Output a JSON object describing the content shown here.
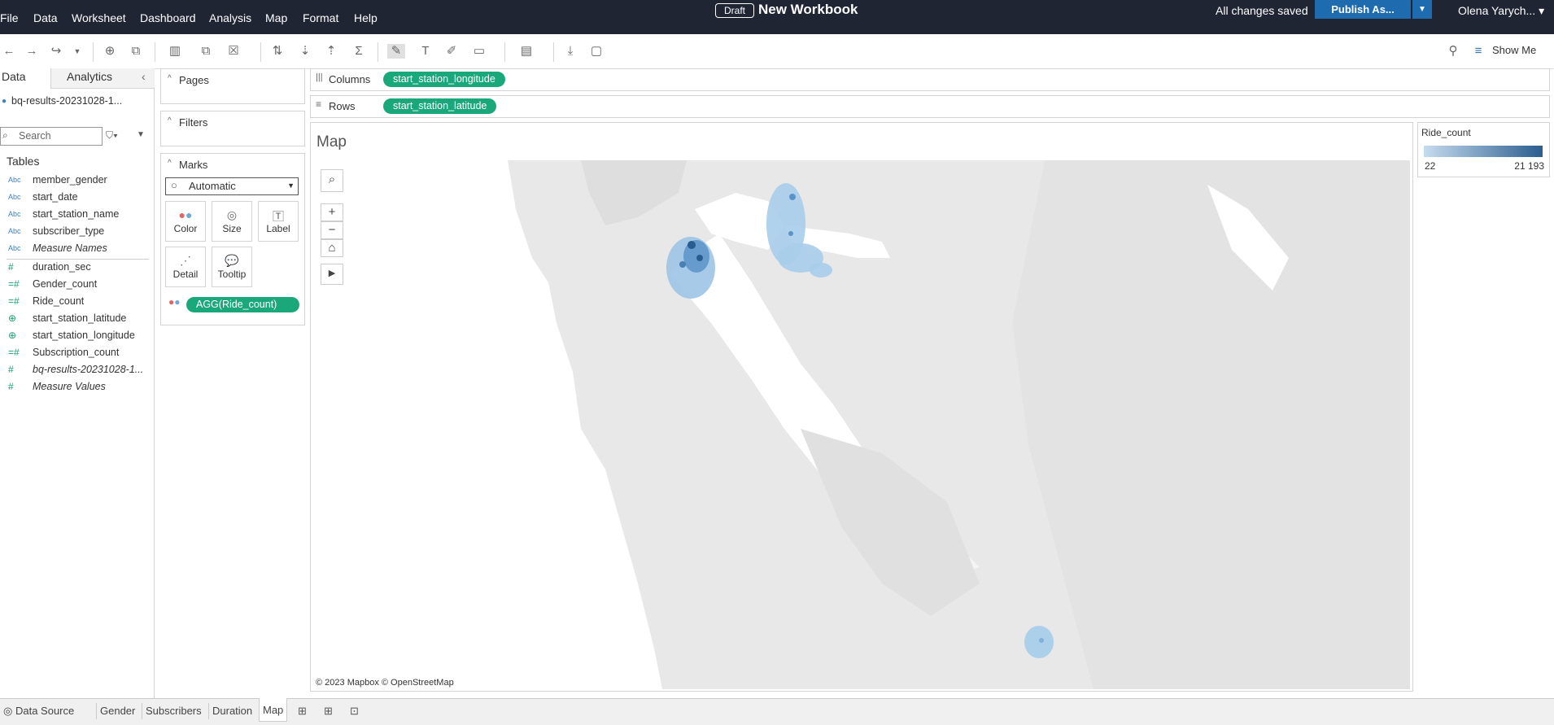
{
  "menubar": {
    "items": [
      "File",
      "Data",
      "Worksheet",
      "Dashboard",
      "Analysis",
      "Map",
      "Format",
      "Help"
    ],
    "draft_badge": "Draft",
    "workbook_title": "New Workbook",
    "save_status": "All changes saved",
    "publish_label": "Publish As...",
    "user": "Olena Yarych..."
  },
  "toolbar": {
    "show_me": "Show Me"
  },
  "data_pane": {
    "tab_data": "Data",
    "tab_analytics": "Analytics",
    "datasource": "bq-results-20231028-1...",
    "search_placeholder": "Search",
    "tables_heading": "Tables",
    "fields": [
      {
        "name": "member_gender",
        "type": "Abc"
      },
      {
        "name": "start_date",
        "type": "Abc"
      },
      {
        "name": "start_station_name",
        "type": "Abc"
      },
      {
        "name": "subscriber_type",
        "type": "Abc"
      },
      {
        "name": "Measure Names",
        "type": "Abc"
      },
      {
        "name": "duration_sec",
        "type": "#"
      },
      {
        "name": "Gender_count",
        "type": "=#"
      },
      {
        "name": "Ride_count",
        "type": "=#"
      },
      {
        "name": "start_station_latitude",
        "type": "globe"
      },
      {
        "name": "start_station_longitude",
        "type": "globe"
      },
      {
        "name": "Subscription_count",
        "type": "=#"
      },
      {
        "name": "bq-results-20231028-1...",
        "type": "#"
      },
      {
        "name": "Measure Values",
        "type": "#"
      }
    ]
  },
  "cards": {
    "pages": "Pages",
    "filters": "Filters",
    "marks": "Marks",
    "mark_type": "Automatic",
    "buttons": [
      "Color",
      "Size",
      "Label",
      "Detail",
      "Tooltip"
    ],
    "color_pill": "AGG(Ride_count)"
  },
  "shelves": {
    "columns_label": "Columns",
    "columns_pill": "start_station_longitude",
    "rows_label": "Rows",
    "rows_pill": "start_station_latitude"
  },
  "view": {
    "title": "Map",
    "attribution": "© 2023 Mapbox  © OpenStreetMap"
  },
  "legend": {
    "title": "Ride_count",
    "min": "22",
    "max": "21 193",
    "color_low": "#c6dbef",
    "color_high": "#2a5d8f"
  },
  "bottom_tabs": {
    "datasource": "Data Source",
    "sheets": [
      "Gender",
      "Subscribers",
      "Duration",
      "Map"
    ],
    "active": "Map"
  }
}
